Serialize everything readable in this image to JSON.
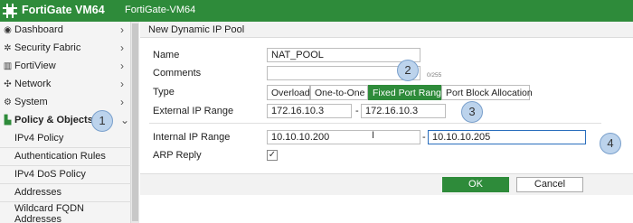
{
  "app": {
    "product": "FortiGate VM64",
    "hostname": "FortiGate-VM64"
  },
  "sidebar": {
    "items": [
      {
        "label": "Dashboard",
        "icon": "dashboard-icon",
        "glyph": "◉"
      },
      {
        "label": "Security Fabric",
        "icon": "security-fabric-icon",
        "glyph": "✲"
      },
      {
        "label": "FortiView",
        "icon": "fortiview-icon",
        "glyph": "▥"
      },
      {
        "label": "Network",
        "icon": "network-icon",
        "glyph": "✣"
      },
      {
        "label": "System",
        "icon": "gear-icon",
        "glyph": "⚙"
      },
      {
        "label": "Policy & Objects",
        "icon": "policy-icon",
        "glyph": "▙"
      }
    ],
    "subitems": [
      {
        "label": "IPv4 Policy"
      },
      {
        "label": "Authentication Rules"
      },
      {
        "label": "IPv4 DoS Policy"
      },
      {
        "label": "Addresses"
      },
      {
        "label": "Wildcard FQDN"
      },
      {
        "label": "Addresses"
      }
    ]
  },
  "page": {
    "title": "New Dynamic IP Pool"
  },
  "form": {
    "name": {
      "label": "Name",
      "value": "NAT_POOL"
    },
    "comments": {
      "label": "Comments",
      "value": "",
      "counter": "0/255"
    },
    "type": {
      "label": "Type",
      "options": [
        "Overload",
        "One-to-One",
        "Fixed Port Range",
        "Port Block Allocation"
      ],
      "selected": "Fixed Port Range"
    },
    "external_ip_range": {
      "label": "External IP Range",
      "start": "172.16.10.3",
      "separator": "-",
      "end": "172.16.10.3"
    },
    "internal_ip_range": {
      "label": "Internal IP Range",
      "start": "10.10.10.200",
      "separator": "-",
      "end": "10.10.10.205"
    },
    "arp_reply": {
      "label": "ARP Reply",
      "checked": true,
      "mark": "✓"
    }
  },
  "buttons": {
    "ok": "OK",
    "cancel": "Cancel"
  },
  "callouts": [
    "1",
    "2",
    "3",
    "4"
  ],
  "colors": {
    "brand_green": "#2e8b3a",
    "callout_blue": "#bcd3ec"
  }
}
